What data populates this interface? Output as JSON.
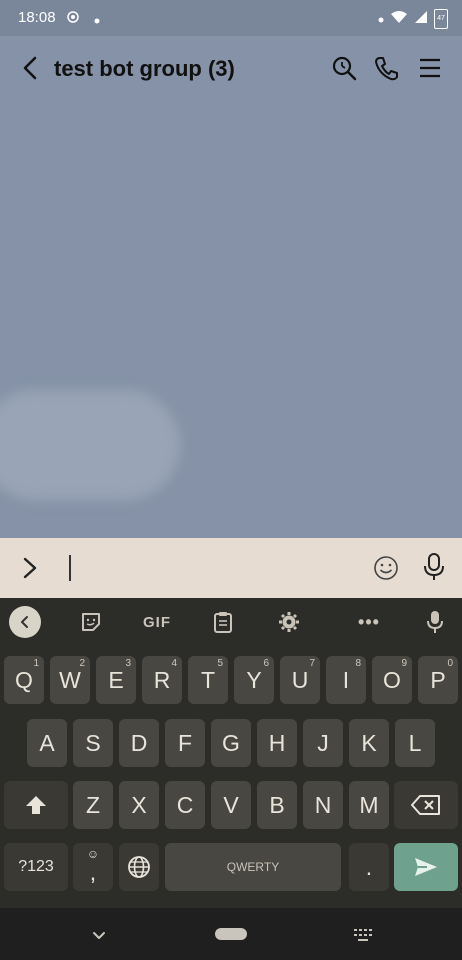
{
  "status_bar": {
    "time": "18:08",
    "battery_level": "47",
    "icons": [
      "gps-icon",
      "notification-dot-icon",
      "wifi-icon",
      "signal-icon",
      "battery-icon"
    ]
  },
  "chat": {
    "title": "test bot group (3)",
    "header_icons": [
      "back-arrow-icon",
      "search-icon",
      "phone-icon",
      "menu-icon"
    ]
  },
  "input_bar": {
    "value": "",
    "placeholder": ""
  },
  "keyboard": {
    "toolbar": {
      "gif_label": "GIF",
      "more_label": "•••",
      "icons": [
        "back-icon",
        "sticker-icon",
        "clipboard-icon",
        "settings-icon",
        "mic-icon"
      ]
    },
    "row1": [
      {
        "label": "Q",
        "hint": "1"
      },
      {
        "label": "W",
        "hint": "2"
      },
      {
        "label": "E",
        "hint": "3"
      },
      {
        "label": "R",
        "hint": "4"
      },
      {
        "label": "T",
        "hint": "5"
      },
      {
        "label": "Y",
        "hint": "6"
      },
      {
        "label": "U",
        "hint": "7"
      },
      {
        "label": "I",
        "hint": "8"
      },
      {
        "label": "O",
        "hint": "9"
      },
      {
        "label": "P",
        "hint": "0"
      }
    ],
    "row2": [
      "A",
      "S",
      "D",
      "F",
      "G",
      "H",
      "J",
      "K",
      "L"
    ],
    "row3": [
      "Z",
      "X",
      "C",
      "V",
      "B",
      "N",
      "M"
    ],
    "row4": {
      "symbols_label": "?123",
      "comma_label": ",",
      "space_label": "QWERTY",
      "period_label": "."
    }
  },
  "colors": {
    "chat_bg": "#8592a7",
    "input_bg": "#e6dcd2",
    "keyboard_bg": "#2c2c28",
    "key_bg": "#484741",
    "send_key": "#6fa28e"
  }
}
